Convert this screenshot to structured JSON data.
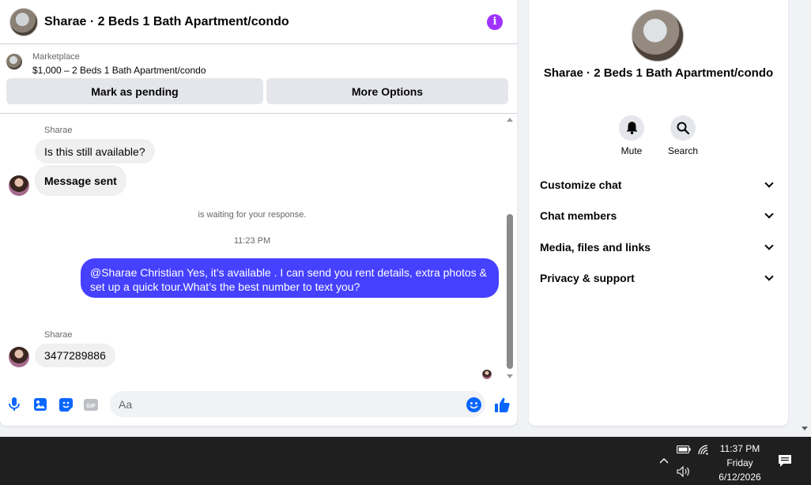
{
  "header": {
    "title": "Sharae · 2 Beds 1 Bath Apartment/condo",
    "accent": "#a033ff"
  },
  "marketplace": {
    "label": "Marketplace",
    "listing": "$1,000 – 2 Beds 1 Bath Apartment/condo",
    "pending_label": "Mark as pending",
    "options_label": "More Options"
  },
  "messages": {
    "sender_1": "Sharae",
    "msg_1": "Is this still available?",
    "msg_2": "Message sent",
    "waiting_note": "is waiting for your response.",
    "timestamp": "11:23 PM",
    "outgoing": "@Sharae Christian Yes, it’s available .  I can send you rent details, extra photos & set up a quick tour.What’s the best number to text you?",
    "sender_2": "Sharae",
    "msg_3": "3477289886",
    "outgoing_color": "#4541ff"
  },
  "composer": {
    "placeholder": "Aa",
    "icons": [
      "microphone-icon",
      "photo-icon",
      "sticker-icon",
      "gif-icon",
      "emoji-icon",
      "thumbs-up-icon"
    ],
    "gif_text": "GIF",
    "accent": "#0866ff"
  },
  "info_panel": {
    "name": "Sharae · 2 Beds 1 Bath Apartment/condo",
    "mute_label": "Mute",
    "search_label": "Search",
    "sections": [
      "Customize chat",
      "Chat members",
      "Media, files and links",
      "Privacy & support"
    ]
  },
  "taskbar": {
    "time": "11:37 PM",
    "day": "Friday",
    "date": "6/12/2026"
  }
}
